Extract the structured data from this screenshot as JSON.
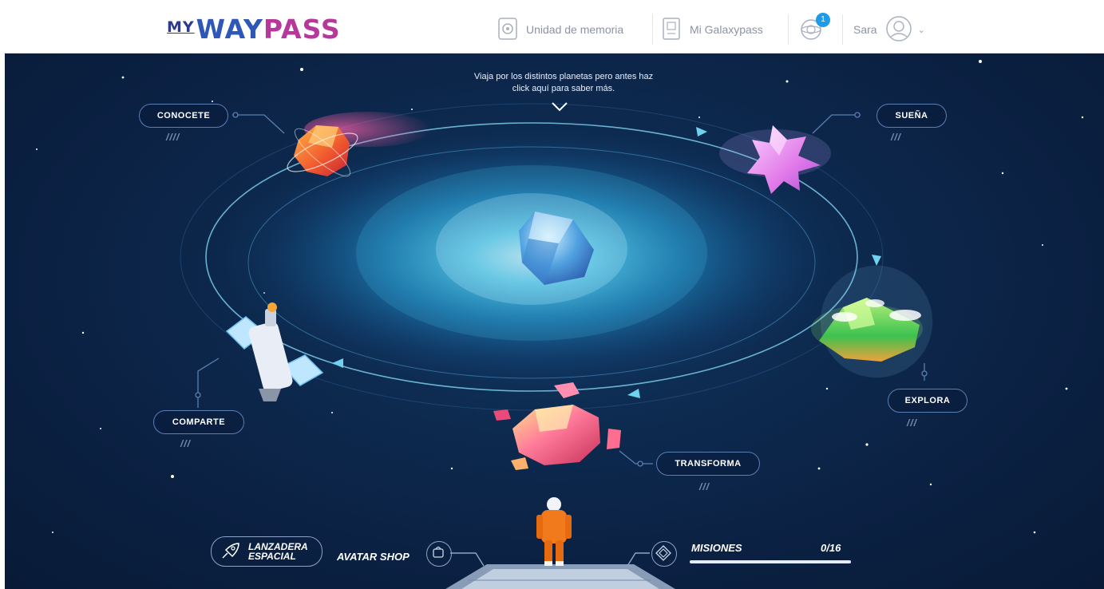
{
  "header": {
    "logo": {
      "my": "MY",
      "way": "WAY",
      "pass": "PASS"
    },
    "nav": {
      "memory_label": "Unidad de memoria",
      "galaxypass_label": "Mi Galaxypass",
      "notifications_count": "1",
      "user_name": "Sara"
    }
  },
  "intro": {
    "line1": "Viaja por los distintos planetas pero antes haz",
    "line2": "click aquí para saber más."
  },
  "planets": {
    "conocete": {
      "label": "CONOCETE",
      "progress": "////"
    },
    "suena": {
      "label": "SUEÑA",
      "progress": "///"
    },
    "explora": {
      "label": "EXPLORA",
      "progress": "///"
    },
    "transforma": {
      "label": "TRANSFORMA",
      "progress": "///"
    },
    "comparte": {
      "label": "COMPARTE",
      "progress": "///"
    }
  },
  "hud": {
    "lanzadera_line1": "LANZADERA",
    "lanzadera_line2": "ESPACIAL",
    "avatar_shop": "AVATAR SHOP",
    "misiones_label": "MISIONES",
    "misiones_value": "0/16",
    "misiones_progress": 0
  },
  "colors": {
    "space_bg": "#0b2143",
    "pill_border": "#5a7fb4",
    "logo_way": "#2f57b8",
    "logo_pass": "#b7389b",
    "badge": "#1e9be6"
  }
}
